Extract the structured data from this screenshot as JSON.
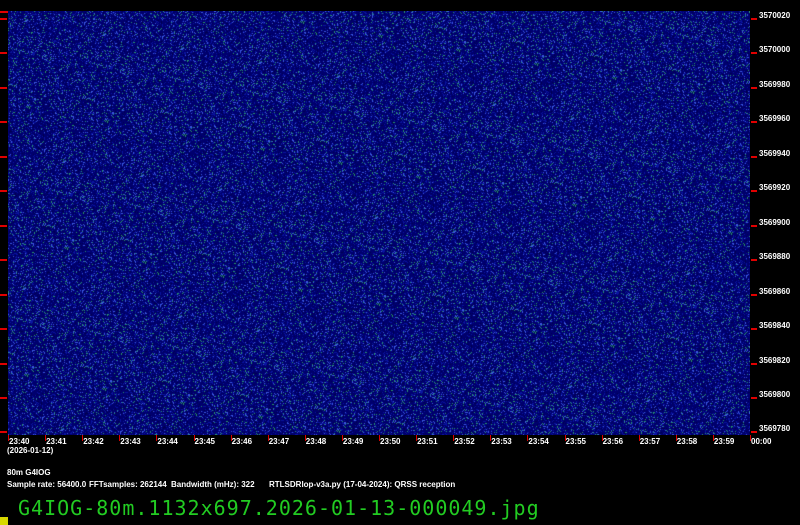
{
  "waterfall": {
    "frequency_labels": [
      "3570020",
      "3570000",
      "3569980",
      "3569960",
      "3569940",
      "3569920",
      "3569900",
      "3569880",
      "3569860",
      "3569840",
      "3569820",
      "3569800",
      "3569780"
    ],
    "time_labels": [
      "23:40",
      "23:41",
      "23:42",
      "23:43",
      "23:44",
      "23:45",
      "23:46",
      "23:47",
      "23:48",
      "23:49",
      "23:50",
      "23:51",
      "23:52",
      "23:53",
      "23:54",
      "23:55",
      "23:56",
      "23:57",
      "23:58",
      "23:59",
      "00:00"
    ],
    "date_label": "(2026-01-12)",
    "colors": {
      "background": "#00006e",
      "noise_blue": "#3a5adf",
      "noise_green": "#2a9a6a",
      "tick": "#e00000"
    }
  },
  "info": {
    "station": "80m G4IOG",
    "sample_rate": "Sample rate: 56400.0",
    "fft_samples": "FFTsamples: 262144",
    "bandwidth": "Bandwidth (mHz): 322",
    "software": "RTLSDRlop-v3a.py (17-04-2024): QRSS reception"
  },
  "filename": "G4IOG-80m.1132x697.2026-01-13-000049.jpg"
}
